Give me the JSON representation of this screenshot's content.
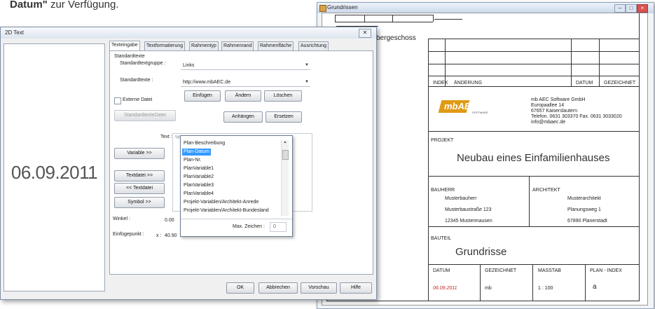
{
  "caption": {
    "bold": "Datum\"",
    "rest": " zur Verfügung."
  },
  "sheet_window": {
    "title": "Grundrissen",
    "floor_label": "bergeschoss",
    "rev_headers": [
      "INDEX",
      "ÄNDERUNG",
      "DATUM",
      "GEZEICHNET"
    ],
    "company": [
      "mb AEC Software GmbH",
      "Europaallee 14",
      "67657 Kaiserslautern",
      "Telefon. 0631 303370  Fax. 0631 3033020",
      "info@mbaec.de"
    ],
    "logo": "mbAEC",
    "logo_sub": "SOFTWARE",
    "projekt_label": "PROJEKT",
    "projekt_value": "Neubau eines Einfamilienhauses",
    "bauherr_label": "BAUHERR",
    "bauherr_lines": [
      "Musterbauherr",
      "Musterbaustraße 123",
      "12345 Mustermausen"
    ],
    "architekt_label": "ARCHITEKT",
    "architekt_lines": [
      "Musterarchitekt",
      "Planungsweg 1",
      "67890 Planerstadt"
    ],
    "bauteil_label": "BAUTEIL",
    "bauteil_value": "Grundrisse",
    "footer_headers": [
      "DATUM",
      "GEZEICHNET",
      "MASSTAB",
      "PLAN - INDEX"
    ],
    "footer_values": [
      "06.09.2011",
      "mb",
      "1 : 100",
      "a"
    ]
  },
  "dialog": {
    "title": "2D Text",
    "preview_date": "06.09.2011",
    "tabs": [
      "Texteingabe",
      "Textformatierung",
      "Rahmentyp",
      "Rahmenrand",
      "Rahmenfläche",
      "Ausrichtung"
    ],
    "group_label": "Standardtexte",
    "textgruppe_label": "Standardtextgruppe :",
    "textgruppe_value": "Links",
    "standardtexte_label": "Standardtexte :",
    "standardtexte_value": "http://www.mbAEC.de",
    "btn_einfuegen": "Einfügen",
    "btn_aendern": "Ändern",
    "btn_loeschen": "Löschen",
    "externe_datei": "Externe Datei",
    "btn_standardtextedatei": "StandardtexteDatei",
    "btn_anhaengen": "Anhängen",
    "btn_ersetzen": "Ersetzen",
    "text_label": "Text :",
    "text_value": "%%",
    "btn_variable": "Variable >>",
    "btn_textdatei": "Textdatei >>",
    "btn_lt_textdatei": "<< Textdatei",
    "btn_symbol": "Symbol >>",
    "winkel_label": "Winkel :",
    "winkel_value": "0.00",
    "einfuege_label": "Einfügepunkt :",
    "einfuege_x": "x :",
    "einfuege_value": "40.90",
    "dropdown_items": [
      "Plan-Beschreibung",
      "Plan-Datum",
      "Plan-Nr.",
      "PlanVariable1",
      "PlanVariable2",
      "PlanVariable3",
      "PlanVariable4",
      "Projekt-Variablen/Architekt-Anrede",
      "Projekt-Variablen/Architekt-Bundesland"
    ],
    "max_zeichen_label": "Max. Zeichen :",
    "max_zeichen_value": "0",
    "btn_ok": "OK",
    "btn_abbrechen": "Abbrechen",
    "btn_vorschau": "Vorschau",
    "btn_hilfe": "Hilfe"
  },
  "colors": {
    "selection": "#3399ff",
    "date_red": "#cc2222"
  }
}
